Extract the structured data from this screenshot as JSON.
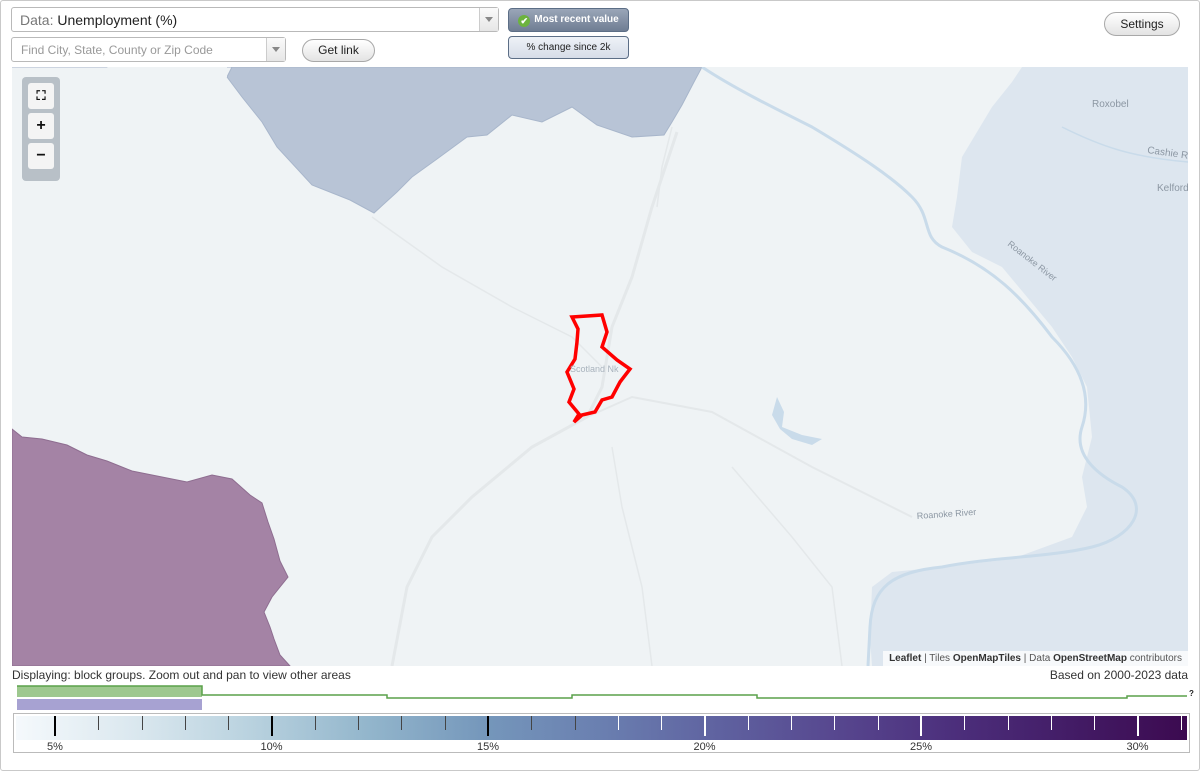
{
  "header": {
    "data_label": "Data:",
    "data_value": "Unemployment (%)",
    "search_placeholder": "Find City, State, County or Zip Code",
    "get_link": "Get link",
    "mode_active": "Most recent value",
    "mode_other": "% change since 2k",
    "settings": "Settings"
  },
  "map": {
    "place_labels": [
      "Roxobel",
      "Cashie Riv",
      "Kelford",
      "Roanoke River",
      "Roanoke River",
      "Scotland Nk"
    ],
    "attribution": {
      "leaflet": "Leaflet",
      "tiles_prefix": "Tiles",
      "tiles": "OpenMapTiles",
      "data_prefix": "Data",
      "data": "OpenStreetMap",
      "contributors": "contributors"
    },
    "colors": {
      "background": "#eff3f5",
      "low_region": "#b8c4d6",
      "high_region": "#a483a5",
      "water": "#dde6ef",
      "highlight": "#ff0000"
    }
  },
  "footer": {
    "displaying": "Displaying: block groups. Zoom out and pan to view other areas",
    "based_on": "Based on 2000-2023 data",
    "question": "?"
  },
  "legend": {
    "labels": [
      "5%",
      "10%",
      "15%",
      "20%",
      "25%",
      "30%"
    ],
    "min": 5,
    "max": 31.5
  }
}
